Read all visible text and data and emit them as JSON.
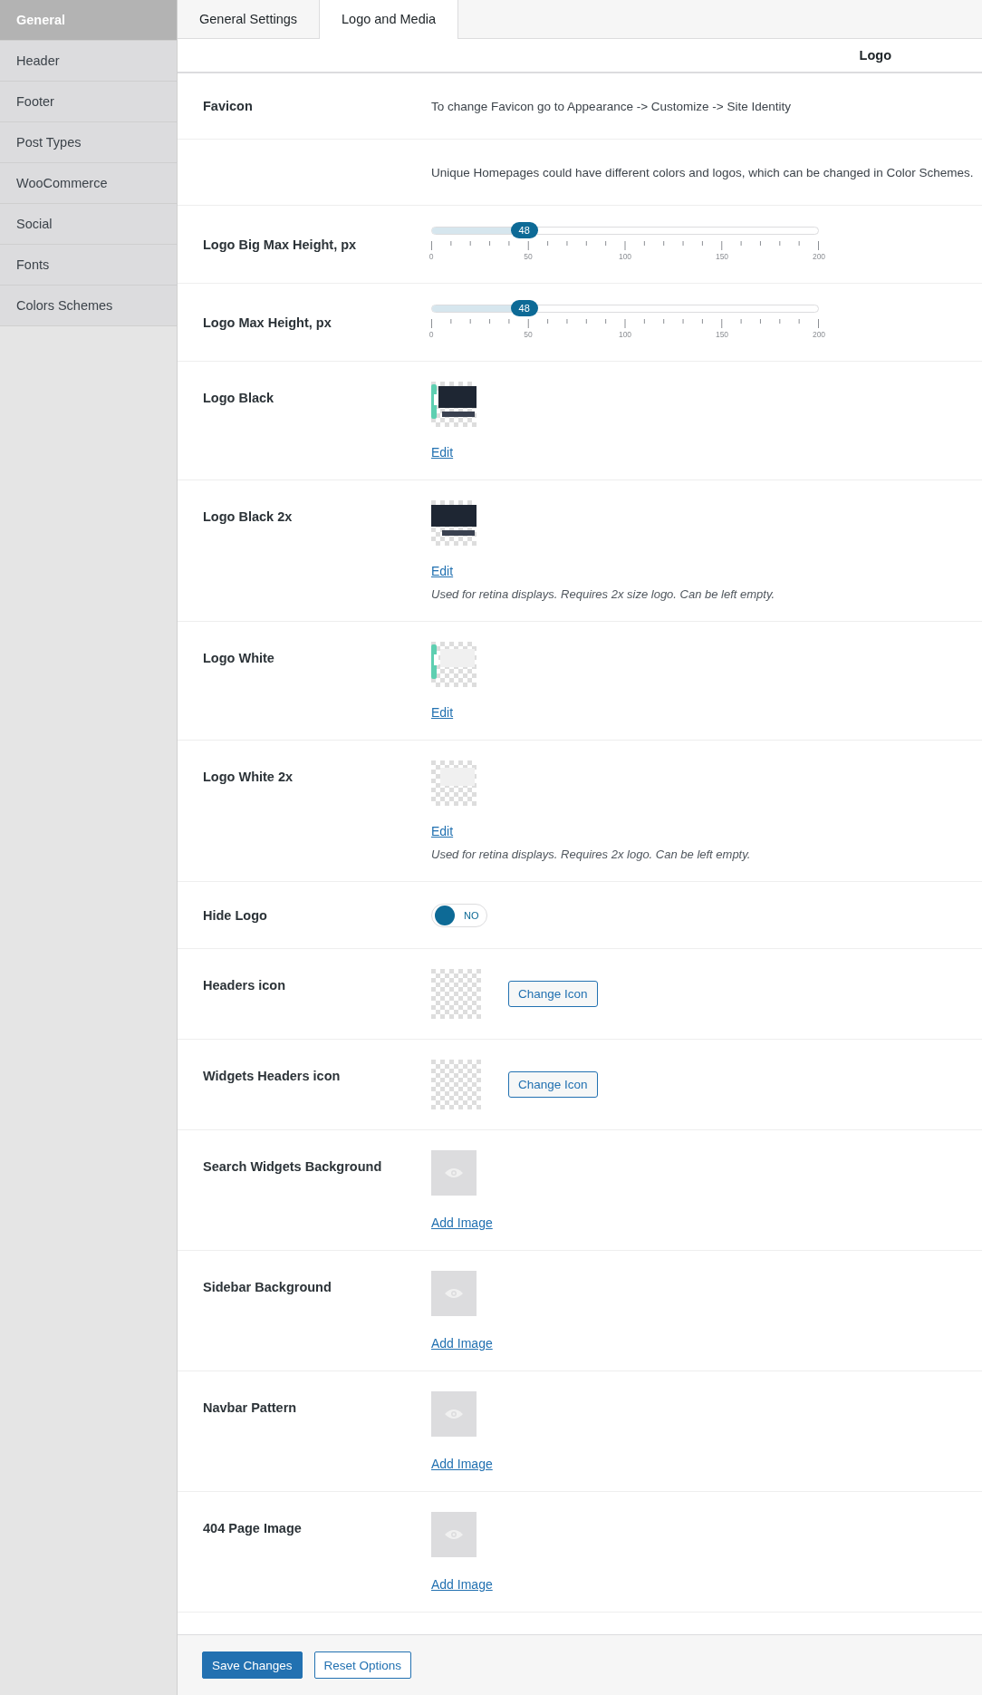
{
  "sidebar": {
    "items": [
      {
        "label": "General",
        "selected": true
      },
      {
        "label": "Header",
        "selected": false
      },
      {
        "label": "Footer",
        "selected": false
      },
      {
        "label": "Post Types",
        "selected": false
      },
      {
        "label": "WooCommerce",
        "selected": false
      },
      {
        "label": "Social",
        "selected": false
      },
      {
        "label": "Fonts",
        "selected": false
      },
      {
        "label": "Colors Schemes",
        "selected": false
      }
    ]
  },
  "tabs": [
    {
      "label": "General Settings",
      "selected": false
    },
    {
      "label": "Logo and Media",
      "selected": true
    }
  ],
  "section_title": "Logo",
  "rows": [
    {
      "kind": "text",
      "label": "Favicon",
      "text": "To change Favicon go to Appearance -> Customize -> Site Identity"
    },
    {
      "kind": "text",
      "text": "Unique Homepages could have different colors and logos, which can be changed in Color Schemes."
    },
    {
      "kind": "slider",
      "label": "Logo Big Max Height, px",
      "level": 0.24,
      "reading": "48",
      "ticks": [
        "0",
        "50",
        "100",
        "150",
        "200"
      ]
    },
    {
      "kind": "slider",
      "label": "Logo Max Height, px",
      "level": 0.24,
      "reading": "48",
      "ticks": [
        "0",
        "50",
        "100",
        "150",
        "200"
      ]
    },
    {
      "kind": "logo",
      "label": "Logo Black",
      "link": "Edit"
    },
    {
      "kind": "logo",
      "label": "Logo Black 2x",
      "link": "Edit",
      "hint": "Used for retina displays. Requires 2x size logo. Can be left empty."
    },
    {
      "kind": "logo",
      "label": "Logo White",
      "link": "Edit"
    },
    {
      "kind": "logo",
      "label": "Logo White 2x",
      "link": "Edit",
      "hint": "Used for retina displays. Requires 2x logo. Can be left empty."
    },
    {
      "kind": "toggle",
      "label": "Hide Logo",
      "on": false,
      "state_text": "NO"
    },
    {
      "kind": "icon",
      "label": "Headers icon",
      "button": "Change Icon"
    },
    {
      "kind": "icon",
      "label": "Widgets Headers icon",
      "button": "Change Icon"
    },
    {
      "label": "Search Widgets Background",
      "link": "Add Image"
    },
    {
      "label": "Sidebar Background",
      "link": "Add Image"
    },
    {
      "label": "Navbar Pattern",
      "link": "Add Image"
    },
    {
      "label": "404 Page Image",
      "link": "Add Image"
    }
  ],
  "buttons": [
    {
      "label": "Save Changes",
      "kind": "primary"
    },
    {
      "label": "Reset Options",
      "kind": "secondary"
    }
  ]
}
